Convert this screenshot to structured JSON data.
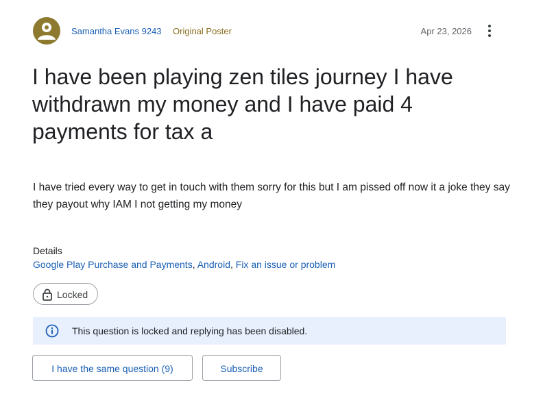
{
  "post": {
    "author": "Samantha Evans 9243",
    "badge": "Original Poster",
    "date": "Apr 23, 2026",
    "title": "I have been playing zen tiles journey I have withdrawn my money and I have paid 4 payments for tax a",
    "body": "I have tried every way to get in touch with them sorry for this but I am pissed off now it a joke they say they payout why IAM I not getting my money"
  },
  "details": {
    "label": "Details",
    "links": [
      "Google Play Purchase and Payments",
      "Android",
      "Fix an issue or problem"
    ],
    "separator": ", "
  },
  "status": {
    "chip_label": "Locked",
    "banner_text": "This question is locked and replying has been disabled."
  },
  "actions": {
    "same_question_label": "I have the same question (9)",
    "subscribe_label": "Subscribe"
  },
  "icons": {
    "avatar": "person-icon",
    "more": "more-vert-icon",
    "lock": "lock-icon",
    "info": "info-icon"
  },
  "colors": {
    "link": "#1a5fb4",
    "badge": "#8a6d1f",
    "avatar_bg": "#8d7a2f",
    "banner_bg": "#e8f0fe",
    "info_icon": "#1a5fb4"
  }
}
